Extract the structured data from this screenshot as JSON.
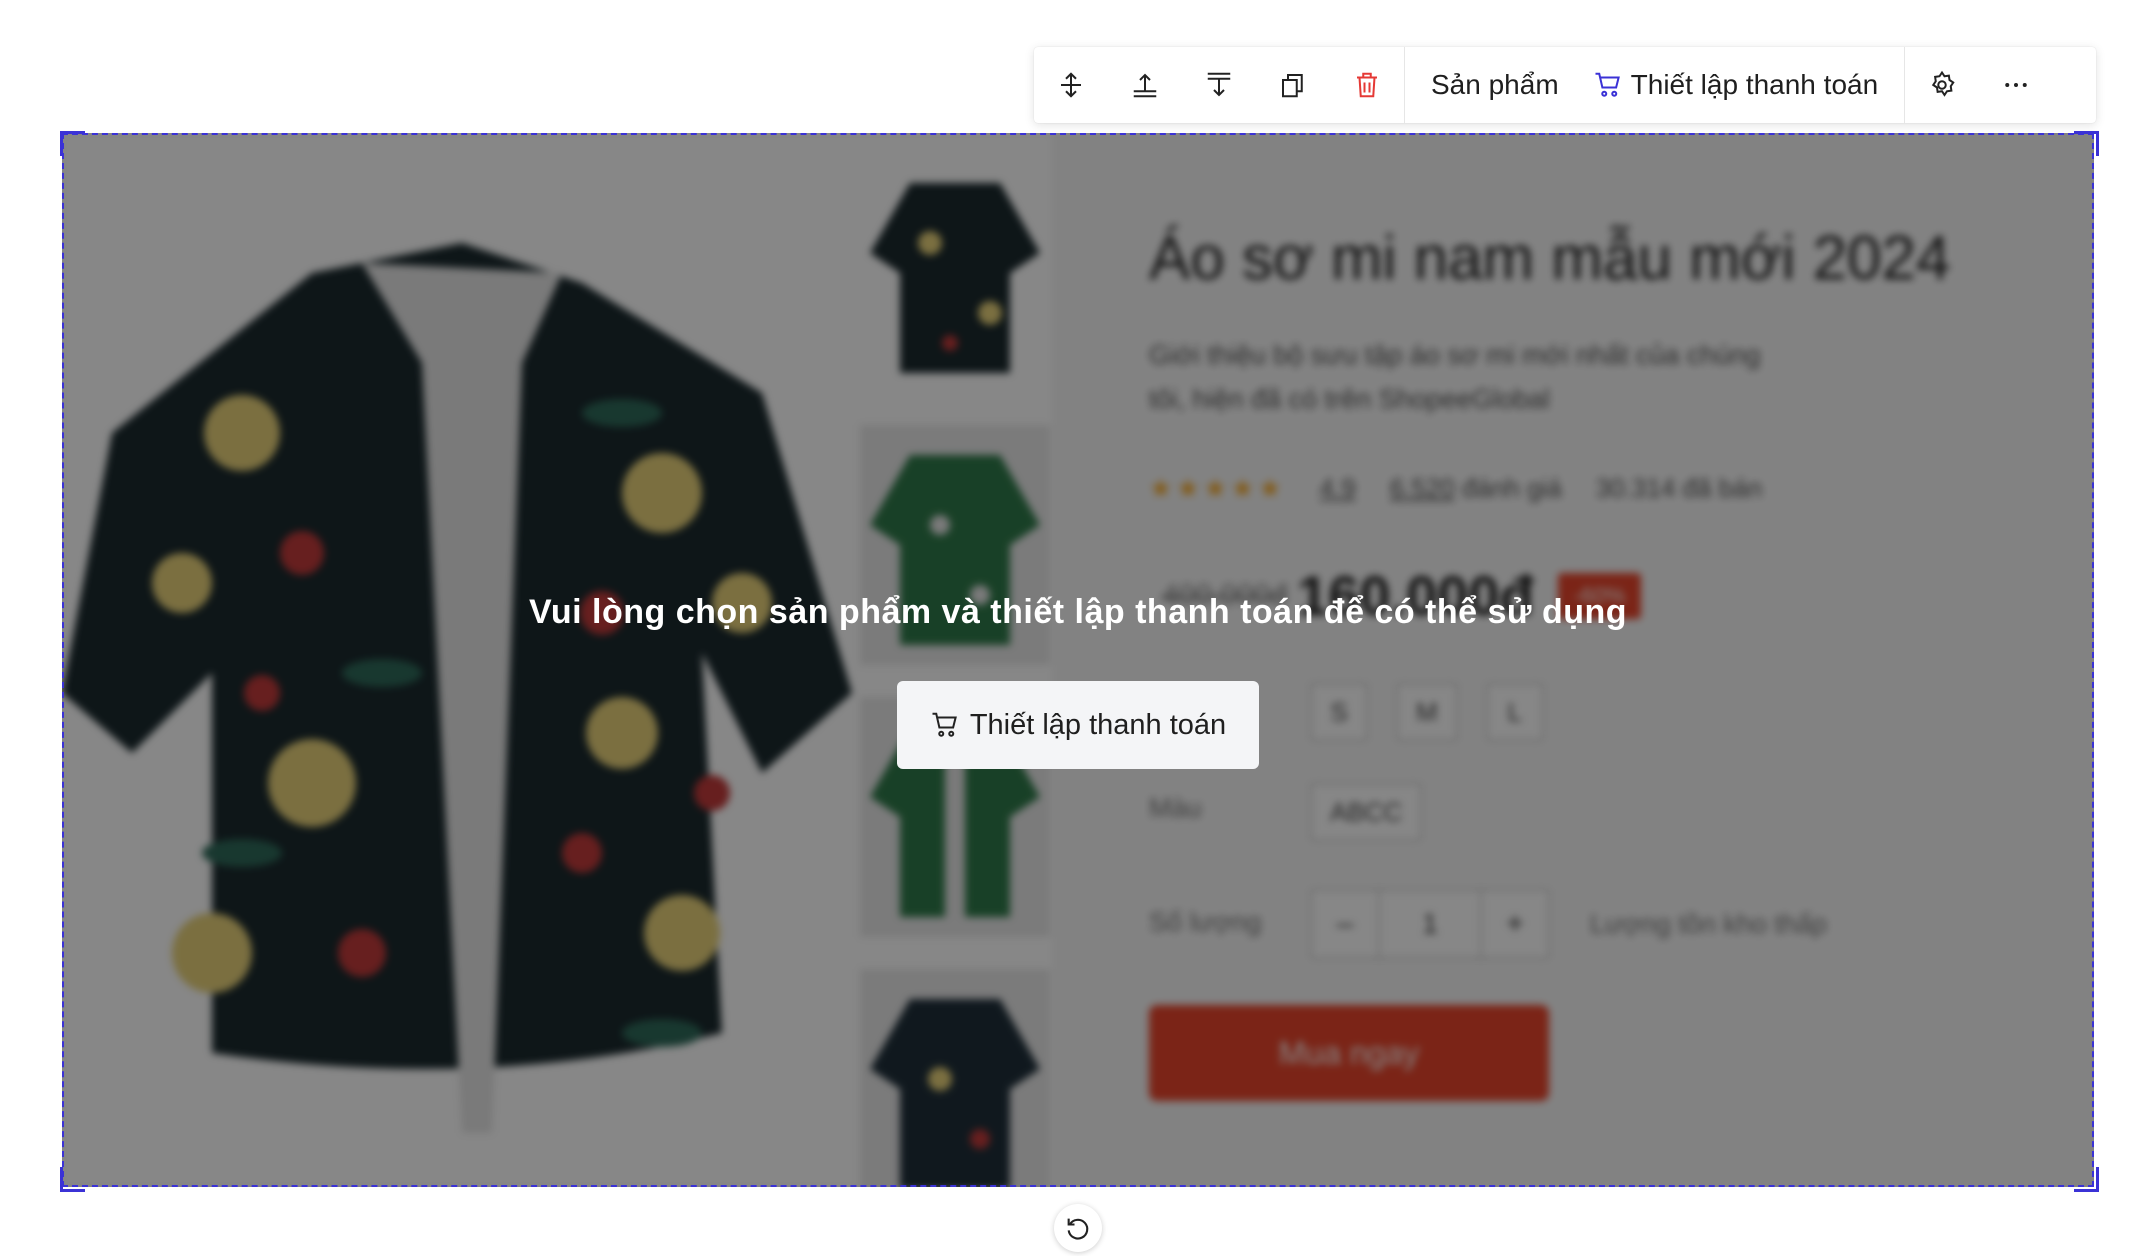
{
  "toolbar": {
    "icons": [
      "move-vertical-icon",
      "move-up-icon",
      "move-down-icon",
      "duplicate-icon",
      "delete-icon",
      "settings-icon",
      "more-icon"
    ],
    "products_label": "Sản phẩm",
    "checkout_label": "Thiết lập thanh toán",
    "accent_color": "#3b32d6",
    "delete_color": "#e53935"
  },
  "product": {
    "title": "Áo sơ mi nam mẫu mới 2024",
    "description": "Giới thiệu bộ sưu tập áo sơ mi mới nhất của chúng tôi, hiện đã có trên ShopeeGlobal",
    "stars": "★★★★★",
    "rating": "4.9",
    "reviews": "6.520",
    "reviews_suffix": "đánh giá",
    "sold": "30.314 đã bán",
    "old_price": "400.000đ",
    "new_price": "160.000đ",
    "discount": "-60%",
    "sizes": [
      "S",
      "M",
      "L"
    ],
    "color_label": "Màu",
    "color_value": "ABCC",
    "quantity_label": "Số lượng",
    "qty_minus": "–",
    "quantity": "1",
    "qty_plus": "+",
    "stock_note": "Lượng tồn kho thấp",
    "buy_label": "Mua ngay",
    "main_image_icon": "floral-shirt-image",
    "thumbnail_count": 4
  },
  "overlay": {
    "message": "Vui lòng chọn sản phẩm và thiết lập thanh toán để có thể sử dụng",
    "button_label": "Thiết lập thanh toán"
  },
  "footer": {
    "reset_icon": "rotate-ccw-icon"
  }
}
